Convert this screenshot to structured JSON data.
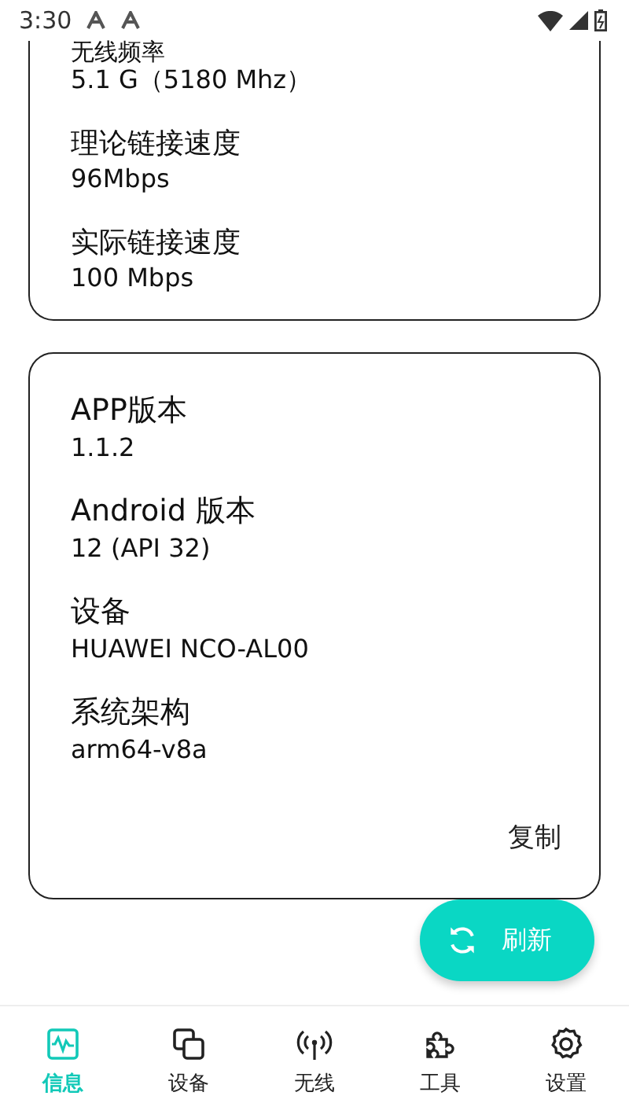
{
  "status_bar": {
    "time": "3:30"
  },
  "cards": [
    {
      "items": [
        {
          "label": "无线频率",
          "value": "5.1 G（5180 Mhz）"
        },
        {
          "label": "理论链接速度",
          "value": "96Mbps"
        },
        {
          "label": "实际链接速度",
          "value": "100 Mbps"
        }
      ]
    },
    {
      "items": [
        {
          "label": "APP版本",
          "value": "1.1.2"
        },
        {
          "label": "Android 版本",
          "value": "12 (API 32)"
        },
        {
          "label": "设备",
          "value": "HUAWEI NCO-AL00"
        },
        {
          "label": "系统架构",
          "value": "arm64-v8a"
        }
      ],
      "action": "复制"
    }
  ],
  "fab": {
    "label": "刷新"
  },
  "nav": [
    {
      "label": "信息",
      "selected": true
    },
    {
      "label": "设备",
      "selected": false
    },
    {
      "label": "无线",
      "selected": false
    },
    {
      "label": "工具",
      "selected": false
    },
    {
      "label": "设置",
      "selected": false
    }
  ]
}
